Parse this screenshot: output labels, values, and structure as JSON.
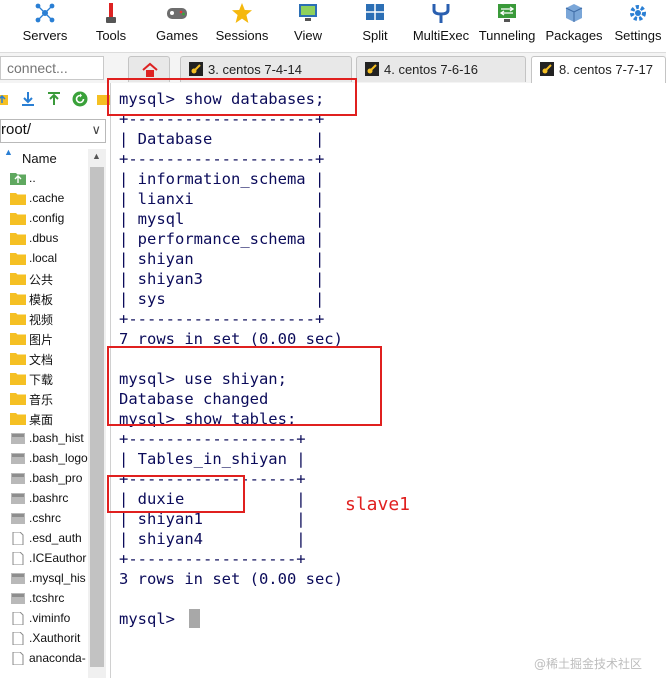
{
  "toolbar": {
    "items": [
      {
        "label": "Servers",
        "icon": "servers-icon"
      },
      {
        "label": "Tools",
        "icon": "tools-icon"
      },
      {
        "label": "Games",
        "icon": "gamepad-icon"
      },
      {
        "label": "Sessions",
        "icon": "star-icon"
      },
      {
        "label": "View",
        "icon": "monitor-icon"
      },
      {
        "label": "Split",
        "icon": "split-icon"
      },
      {
        "label": "MultiExec",
        "icon": "fork-icon"
      },
      {
        "label": "Tunneling",
        "icon": "tunnel-icon"
      },
      {
        "label": "Packages",
        "icon": "package-icon"
      },
      {
        "label": "Settings",
        "icon": "gear-icon"
      }
    ]
  },
  "tabs": {
    "connect_placeholder": "connect...",
    "home_icon": "home-icon",
    "items": [
      {
        "label": "3. centos 7-4-14",
        "active": false
      },
      {
        "label": "4. centos 7-6-16",
        "active": false
      },
      {
        "label": "8. centos 7-7-17",
        "active": true
      }
    ]
  },
  "sidebar": {
    "path": "root/",
    "column_header": "Name",
    "files": [
      {
        "name": "..",
        "type": "up"
      },
      {
        "name": ".cache",
        "type": "folder"
      },
      {
        "name": ".config",
        "type": "folder"
      },
      {
        "name": ".dbus",
        "type": "folder"
      },
      {
        "name": ".local",
        "type": "folder"
      },
      {
        "name": "公共",
        "type": "folder"
      },
      {
        "name": "模板",
        "type": "folder"
      },
      {
        "name": "视频",
        "type": "folder"
      },
      {
        "name": "图片",
        "type": "folder"
      },
      {
        "name": "文档",
        "type": "folder"
      },
      {
        "name": "下载",
        "type": "folder"
      },
      {
        "name": "音乐",
        "type": "folder"
      },
      {
        "name": "桌面",
        "type": "folder"
      },
      {
        "name": ".bash_hist",
        "type": "file"
      },
      {
        "name": ".bash_logo",
        "type": "file"
      },
      {
        "name": ".bash_pro",
        "type": "file"
      },
      {
        "name": ".bashrc",
        "type": "file"
      },
      {
        "name": ".cshrc",
        "type": "file"
      },
      {
        "name": ".esd_auth",
        "type": "doc"
      },
      {
        "name": ".ICEauthor",
        "type": "doc"
      },
      {
        "name": ".mysql_his",
        "type": "file"
      },
      {
        "name": ".tcshrc",
        "type": "file"
      },
      {
        "name": ".viminfo",
        "type": "doc"
      },
      {
        "name": ".Xauthorit",
        "type": "doc"
      },
      {
        "name": "anaconda-",
        "type": "doc"
      }
    ]
  },
  "terminal": {
    "lines": [
      "mysql> show databases;",
      "+--------------------+",
      "| Database           |",
      "+--------------------+",
      "| information_schema |",
      "| lianxi             |",
      "| mysql              |",
      "| performance_schema |",
      "| shiyan             |",
      "| shiyan3            |",
      "| sys                |",
      "+--------------------+",
      "7 rows in set (0.00 sec)",
      "",
      "mysql> use shiyan;",
      "Database changed",
      "mysql> show tables;",
      "+------------------+",
      "| Tables_in_shiyan |",
      "+------------------+",
      "| duxie            |",
      "| shiyan1          |",
      "| shiyan4          |",
      "+------------------+",
      "3 rows in set (0.00 sec)",
      "",
      "mysql> "
    ],
    "annotation": "slave1",
    "watermark": "@稀土掘金技术社区"
  },
  "colors": {
    "terminal_text": "#0b0b5a",
    "annotation_red": "#e0201f",
    "folder_yellow": "#f5c023"
  }
}
